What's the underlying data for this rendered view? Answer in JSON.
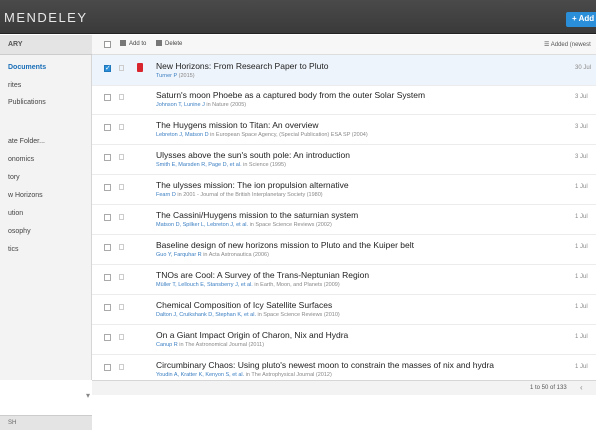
{
  "app": {
    "brand": "MENDELEY",
    "add_label": "+ Add"
  },
  "sidebar": {
    "header": "ARY",
    "items": [
      {
        "label": "Documents",
        "active": true
      },
      {
        "label": "rites"
      },
      {
        "label": "Publications"
      },
      {
        "label": "ate Folder..."
      },
      {
        "label": "onomics"
      },
      {
        "label": "tory"
      },
      {
        "label": "w Horizons"
      },
      {
        "label": "ution"
      },
      {
        "label": "osophy"
      },
      {
        "label": "tics"
      }
    ],
    "footer": "SH"
  },
  "toolbar": {
    "add_to": "Add to",
    "delete": "Delete",
    "sort": "Added (newest"
  },
  "documents": [
    {
      "title": "New Horizons: From Research Paper to Pluto",
      "authors": "Turner P",
      "source": "(2015)",
      "added": "30 Jul",
      "selected": true,
      "pdf": true
    },
    {
      "title": "Saturn's moon Phoebe as a captured body from the outer Solar System",
      "authors": "Johnson T, Lunine J",
      "source": "in Nature (2005)",
      "added": "3 Jul"
    },
    {
      "title": "The Huygens mission to Titan: An overview",
      "authors": "Lebreton J, Matson D",
      "source": "in European Space Agency, (Special Publication) ESA SP (2004)",
      "added": "3 Jul"
    },
    {
      "title": "Ulysses above the sun's south pole: An introduction",
      "authors": "Smith E, Marsden R, Page D, et al.",
      "source": "in Science (1995)",
      "added": "3 Jul"
    },
    {
      "title": "The ulysses mission: The ion propulsion alternative",
      "authors": "Fearn D",
      "source": "in 2001 - Journal of the British Interplanetary Society (1980)",
      "added": "1 Jul"
    },
    {
      "title": "The Cassini/Huygens mission to the saturnian system",
      "authors": "Matson D, Spilker L, Lebreton J, et al.",
      "source": "in Space Science Reviews (2002)",
      "added": "1 Jul"
    },
    {
      "title": "Baseline design of new horizons mission to Pluto and the Kuiper belt",
      "authors": "Guo Y, Farquhar R",
      "source": "in Acta Astronautica (2006)",
      "added": "1 Jul"
    },
    {
      "title": "TNOs are Cool: A Survey of the Trans-Neptunian Region",
      "authors": "Müller T, Lellouch E, Stansberry J, et al.",
      "source": "in Earth, Moon, and Planets (2009)",
      "added": "1 Jul"
    },
    {
      "title": "Chemical Composition of Icy Satellite Surfaces",
      "authors": "Dalton J, Cruikshank D, Stephan K, et al.",
      "source": "in Space Science Reviews (2010)",
      "added": "1 Jul"
    },
    {
      "title": "On a Giant Impact Origin of Charon, Nix and Hydra",
      "authors": "Canup R",
      "source": "in The Astronomical Journal (2011)",
      "added": "1 Jul"
    },
    {
      "title": "Circumbinary Chaos: Using pluto's newest moon to constrain the masses of nix and hydra",
      "authors": "Youdin A, Kratter K, Kenyon S, et al.",
      "source": "in The Astrophysical Journal (2012)",
      "added": "1 Jul"
    }
  ],
  "status": {
    "paging": "1 to 50 of 133"
  }
}
